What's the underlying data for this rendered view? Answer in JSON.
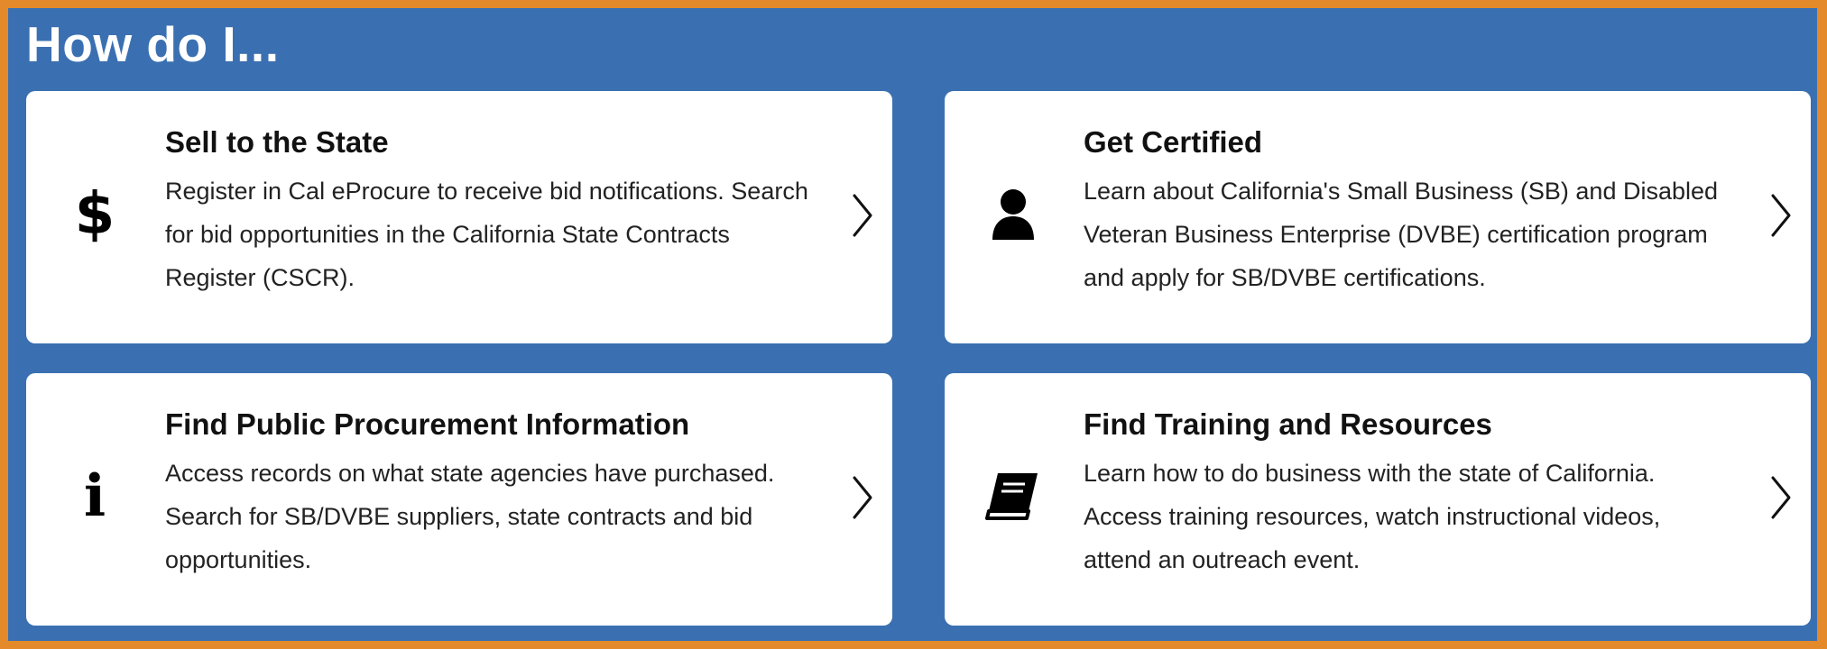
{
  "section": {
    "title": "How do I..."
  },
  "cards": [
    {
      "title": "Sell to the State",
      "description": "Register in Cal eProcure to receive bid notifications. Search for bid opportunities in the California State Contracts Register (CSCR).",
      "icon": "dollar-sign-icon",
      "icon_glyph": "$"
    },
    {
      "title": "Get Certified",
      "description": "Learn about California's Small Business (SB) and Disabled Veteran Business Enterprise (DVBE) certification program and apply for SB/DVBE certifications.",
      "icon": "user-icon"
    },
    {
      "title": "Find Public Procurement Information",
      "description": "Access records on what state agencies have purchased. Search for SB/DVBE suppliers, state contracts and bid opportunities.",
      "icon": "info-icon",
      "icon_glyph": "i"
    },
    {
      "title": "Find Training and Resources",
      "description": "Learn how to do business with the state of California. Access training resources, watch instructional videos, attend an outreach event.",
      "icon": "book-icon"
    }
  ],
  "colors": {
    "border": "#e48a2b",
    "panel": "#3a70b1",
    "card": "#ffffff",
    "text": "#111111"
  }
}
